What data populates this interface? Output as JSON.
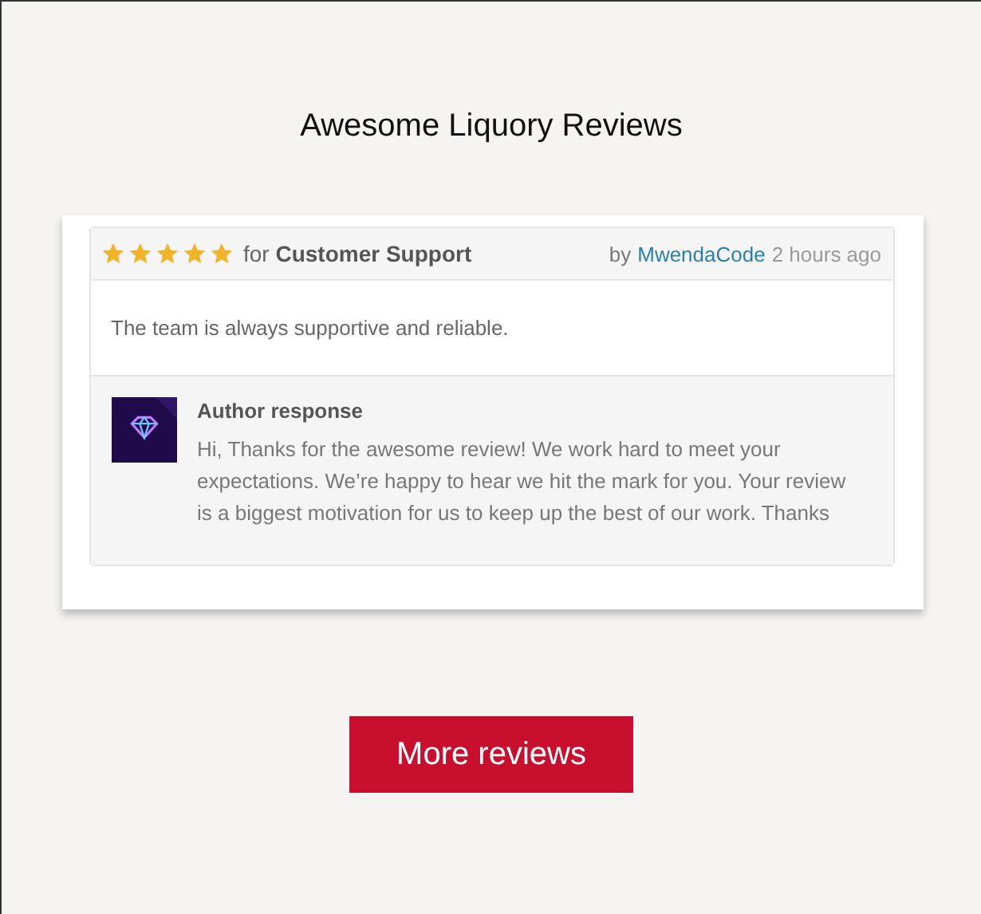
{
  "title": "Awesome Liquory Reviews",
  "review": {
    "stars": 5,
    "category": "for **Customer Support**",
    "by": "by",
    "author": "MwendaCode",
    "time": "2 hours ago",
    "body": "The team is always supportive and reliable.",
    "response": {
      "heading": "Author response",
      "text": "Hi, Thanks for the awesome review! We work hard to meet your expectations. We’re happy to hear we hit the mark for you. Your review is a biggest motivation for us to keep up the best of our work. Thanks"
    }
  },
  "button": "More reviews"
}
